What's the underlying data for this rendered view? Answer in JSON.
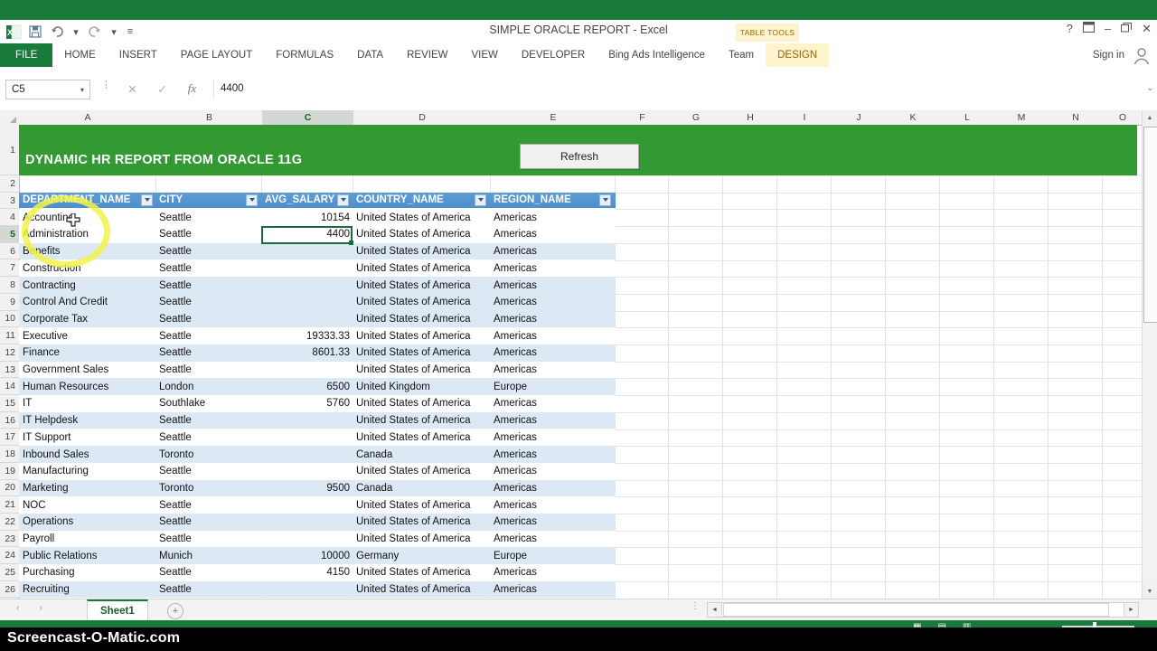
{
  "window": {
    "title": "SIMPLE ORACLE REPORT - Excel",
    "quick_access": [
      {
        "name": "save-icon",
        "glyph": "💾"
      },
      {
        "name": "undo-icon",
        "glyph": "↶"
      },
      {
        "name": "undo-dropdown-icon",
        "glyph": "▾"
      },
      {
        "name": "redo-icon",
        "glyph": "↷"
      },
      {
        "name": "redo-dropdown-icon",
        "glyph": "▾"
      },
      {
        "name": "customize-qat-icon",
        "glyph": "≡"
      }
    ],
    "controls": {
      "help": "?",
      "ribbon_display": "⏭",
      "minimize": "–",
      "restore": "❐",
      "close": "✕"
    }
  },
  "contextual_tab": {
    "label": "TABLE TOOLS"
  },
  "ribbon": {
    "tabs": [
      {
        "label": "FILE",
        "kind": "file"
      },
      {
        "label": "HOME",
        "kind": "normal"
      },
      {
        "label": "INSERT",
        "kind": "normal"
      },
      {
        "label": "PAGE LAYOUT",
        "kind": "normal"
      },
      {
        "label": "FORMULAS",
        "kind": "normal"
      },
      {
        "label": "DATA",
        "kind": "normal"
      },
      {
        "label": "REVIEW",
        "kind": "normal"
      },
      {
        "label": "VIEW",
        "kind": "normal"
      },
      {
        "label": "DEVELOPER",
        "kind": "normal"
      },
      {
        "label": "Bing Ads Intelligence",
        "kind": "normal"
      },
      {
        "label": "Team",
        "kind": "normal"
      },
      {
        "label": "DESIGN",
        "kind": "design"
      }
    ],
    "sign_in": "Sign in"
  },
  "formula_bar": {
    "name_box_value": "C5",
    "name_box_arrow": "▾",
    "cancel_icon": "✕",
    "enter_icon": "✓",
    "function_icon": "fx",
    "formula_value": "4400",
    "expand_icon": "⌄"
  },
  "grid": {
    "column_headers": [
      "A",
      "B",
      "C",
      "D",
      "E",
      "F",
      "G",
      "H",
      "I",
      "J",
      "K",
      "L",
      "M",
      "N",
      "O"
    ],
    "selected_column": "C",
    "selected_row": 5,
    "row_numbers": [
      1,
      2,
      3,
      4,
      5,
      6,
      7,
      8,
      9,
      10,
      11,
      12,
      13,
      14,
      15,
      16,
      17,
      18,
      19,
      20,
      21,
      22,
      23,
      24,
      25,
      26
    ]
  },
  "banner": {
    "title": "DYNAMIC HR REPORT  FROM ORACLE 11G",
    "color": "#339933",
    "refresh_label": "Refresh"
  },
  "table": {
    "header_color": "#5b9bd5",
    "band_color": "#dce9f5",
    "filter_icon": "filter-dropdown-icon",
    "columns": [
      "DEPARTMENT_NAME",
      "CITY",
      "AVG_SALARY",
      "COUNTRY_NAME",
      "REGION_NAME"
    ],
    "rows": [
      {
        "row": 4,
        "department": "Accounting",
        "city": "Seattle",
        "avg_salary": "10154",
        "country": "United States of America",
        "region": "Americas"
      },
      {
        "row": 5,
        "department": "Administration",
        "city": "Seattle",
        "avg_salary": "4400",
        "country": "United States of America",
        "region": "Americas"
      },
      {
        "row": 6,
        "department": "Benefits",
        "city": "Seattle",
        "avg_salary": "",
        "country": "United States of America",
        "region": "Americas"
      },
      {
        "row": 7,
        "department": "Construction",
        "city": "Seattle",
        "avg_salary": "",
        "country": "United States of America",
        "region": "Americas"
      },
      {
        "row": 8,
        "department": "Contracting",
        "city": "Seattle",
        "avg_salary": "",
        "country": "United States of America",
        "region": "Americas"
      },
      {
        "row": 9,
        "department": "Control And Credit",
        "city": "Seattle",
        "avg_salary": "",
        "country": "United States of America",
        "region": "Americas"
      },
      {
        "row": 10,
        "department": "Corporate Tax",
        "city": "Seattle",
        "avg_salary": "",
        "country": "United States of America",
        "region": "Americas"
      },
      {
        "row": 11,
        "department": "Executive",
        "city": "Seattle",
        "avg_salary": "19333.33",
        "country": "United States of America",
        "region": "Americas"
      },
      {
        "row": 12,
        "department": "Finance",
        "city": "Seattle",
        "avg_salary": "8601.33",
        "country": "United States of America",
        "region": "Americas"
      },
      {
        "row": 13,
        "department": "Government Sales",
        "city": "Seattle",
        "avg_salary": "",
        "country": "United States of America",
        "region": "Americas"
      },
      {
        "row": 14,
        "department": "Human Resources",
        "city": "London",
        "avg_salary": "6500",
        "country": "United Kingdom",
        "region": "Europe"
      },
      {
        "row": 15,
        "department": "IT",
        "city": "Southlake",
        "avg_salary": "5760",
        "country": "United States of America",
        "region": "Americas"
      },
      {
        "row": 16,
        "department": "IT Helpdesk",
        "city": "Seattle",
        "avg_salary": "",
        "country": "United States of America",
        "region": "Americas"
      },
      {
        "row": 17,
        "department": "IT Support",
        "city": "Seattle",
        "avg_salary": "",
        "country": "United States of America",
        "region": "Americas"
      },
      {
        "row": 18,
        "department": "Inbound Sales",
        "city": "Toronto",
        "avg_salary": "",
        "country": "Canada",
        "region": "Americas"
      },
      {
        "row": 19,
        "department": "Manufacturing",
        "city": "Seattle",
        "avg_salary": "",
        "country": "United States of America",
        "region": "Americas"
      },
      {
        "row": 20,
        "department": "Marketing",
        "city": "Toronto",
        "avg_salary": "9500",
        "country": "Canada",
        "region": "Americas"
      },
      {
        "row": 21,
        "department": "NOC",
        "city": "Seattle",
        "avg_salary": "",
        "country": "United States of America",
        "region": "Americas"
      },
      {
        "row": 22,
        "department": "Operations",
        "city": "Seattle",
        "avg_salary": "",
        "country": "United States of America",
        "region": "Americas"
      },
      {
        "row": 23,
        "department": "Payroll",
        "city": "Seattle",
        "avg_salary": "",
        "country": "United States of America",
        "region": "Americas"
      },
      {
        "row": 24,
        "department": "Public Relations",
        "city": "Munich",
        "avg_salary": "10000",
        "country": "Germany",
        "region": "Europe"
      },
      {
        "row": 25,
        "department": "Purchasing",
        "city": "Seattle",
        "avg_salary": "4150",
        "country": "United States of America",
        "region": "Americas"
      },
      {
        "row": 26,
        "department": "Recruiting",
        "city": "Seattle",
        "avg_salary": "",
        "country": "United States of America",
        "region": "Americas"
      }
    ]
  },
  "sheet_tabs": {
    "prev_icon": "‹",
    "next_icon": "›",
    "tabs": [
      "Sheet1"
    ],
    "active": "Sheet1",
    "add_label": "+"
  },
  "scroll": {
    "v_up": "▲",
    "v_down": "▼",
    "h_left": "◄",
    "h_right": "►"
  },
  "status_bar": {
    "view_normal": "▦",
    "view_layout": "▤",
    "view_break": "▥",
    "zoom_label": ""
  },
  "watermark": {
    "text": "Screencast-O-Matic.com"
  }
}
